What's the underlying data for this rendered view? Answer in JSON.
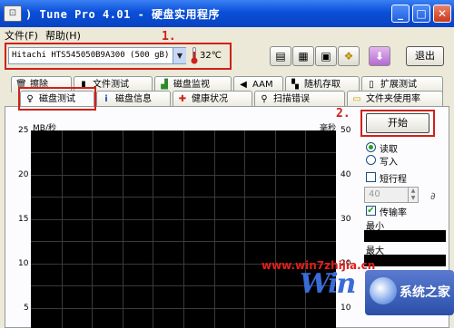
{
  "window": {
    "title": ") Tune Pro 4.01 - 硬盘实用程序"
  },
  "menu": [
    {
      "label": "文件(F)"
    },
    {
      "label": "帮助(H)"
    }
  ],
  "toolbar": {
    "device_value": "Hitachi HTS545050B9A300 (500 gB)",
    "temperature": "32℃",
    "exit_label": "退出",
    "buttons": [
      {
        "icon": "copy-info-icon"
      },
      {
        "icon": "copy-screenshot-icon"
      },
      {
        "icon": "save-icon"
      },
      {
        "icon": "options-icon"
      },
      {
        "icon": "minimize-to-tray-icon"
      }
    ]
  },
  "annotations": {
    "step1": "1.",
    "step2": "2."
  },
  "tabs_row1": [
    {
      "label": "擦除",
      "icon": "erase-icon"
    },
    {
      "label": "文件测试",
      "icon": "file-test-icon"
    },
    {
      "label": "磁盘监视",
      "icon": "disk-monitor-icon"
    },
    {
      "label": "AAM",
      "icon": "speaker-icon"
    },
    {
      "label": "随机存取",
      "icon": "random-access-icon"
    },
    {
      "label": "扩展测试",
      "icon": "extra-tests-icon"
    }
  ],
  "tabs_row2": [
    {
      "label": "磁盘测试",
      "icon": "benchmark-icon",
      "active": true
    },
    {
      "label": "磁盘信息",
      "icon": "info-icon"
    },
    {
      "label": "健康状况",
      "icon": "health-icon"
    },
    {
      "label": "扫描错误",
      "icon": "error-scan-icon"
    },
    {
      "label": "文件夹使用率",
      "icon": "folder-usage-icon"
    }
  ],
  "chart": {
    "left_unit": "MB/秒",
    "right_unit": "毫秒",
    "left_ticks": [
      "25",
      "20",
      "15",
      "10",
      "5"
    ],
    "right_ticks": [
      "50",
      "40",
      "30",
      "20",
      "10"
    ]
  },
  "right_panel": {
    "start_label": "开始",
    "read_label": "读取",
    "write_label": "写入",
    "short_stroke_label": "短行程",
    "short_stroke_value": "40",
    "transfer_rate_label": "传输率",
    "min_label": "最小",
    "max_label": "最大"
  },
  "watermark": {
    "url": "www.win7zhijia.cn",
    "logo": "Win",
    "brand": "系统之家"
  }
}
